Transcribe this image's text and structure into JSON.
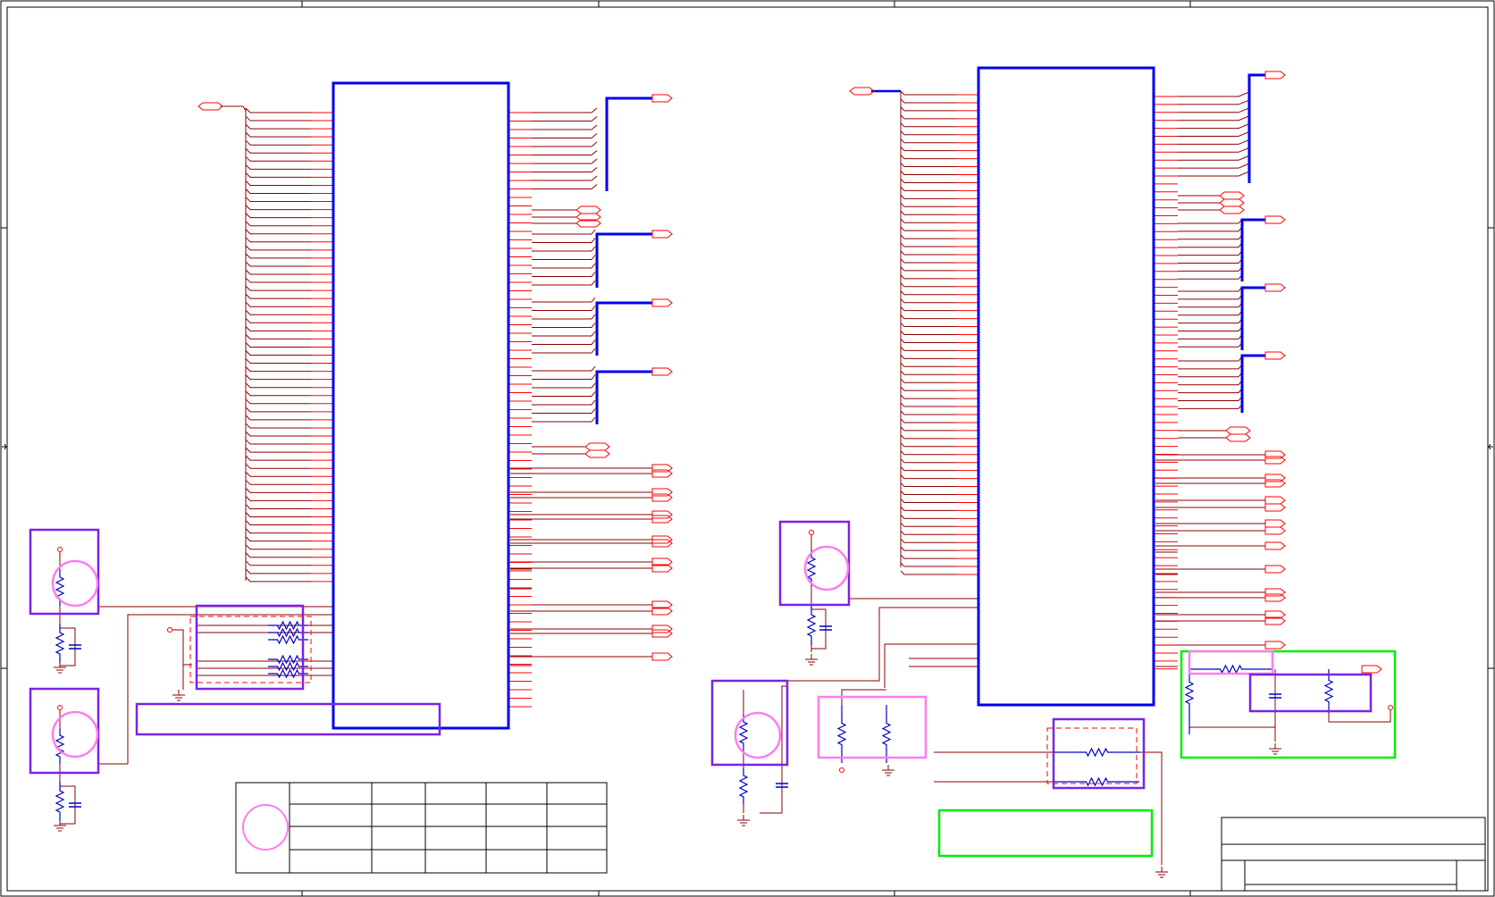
{
  "colors": {
    "frame": "#000000",
    "wire": "#8B0000",
    "pin": "#FF0000",
    "bus": "#0000EE",
    "component": "#0000CC",
    "box_purple": "#7B22E6",
    "box_pink": "#FF7CF0",
    "box_green": "#00EE00",
    "background": "#FFFFFF"
  },
  "schematic": {
    "left_chip_left_pins": 59,
    "left_chip_right_pins": 71,
    "right_chip_left_pins": 61,
    "right_chip_right_pins": 73,
    "power_symbols": 7,
    "ground_symbols": 9,
    "revision_table_rows": 4,
    "revision_table_columns": 6
  }
}
